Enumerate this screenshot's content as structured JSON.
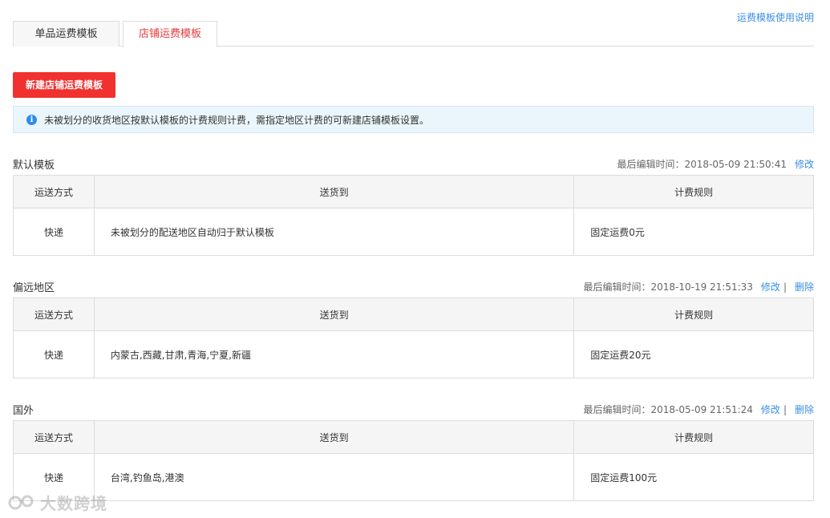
{
  "help_link": "运费模板使用说明",
  "tabs": [
    {
      "label": "单品运费模板",
      "active": false
    },
    {
      "label": "店铺运费模板",
      "active": true
    }
  ],
  "new_button": "新建店铺运费模板",
  "notice": "未被划分的收货地区按默认模板的计费规则计费，需指定地区计费的可新建店铺模板设置。",
  "table_headers": [
    "运送方式",
    "送货到",
    "计费规则"
  ],
  "sections": [
    {
      "title": "默认模板",
      "meta": "最后编辑时间：2018-05-09 21:50:41",
      "edit": "修改",
      "sep": "",
      "delete": "",
      "row": {
        "method": "快递",
        "dest": "未被划分的配送地区自动归于默认模板",
        "rule": "固定运费0元"
      }
    },
    {
      "title": "偏远地区",
      "meta": "最后编辑时间：2018-10-19 21:51:33",
      "edit": "修改",
      "sep": "|",
      "delete": "删除",
      "row": {
        "method": "快递",
        "dest": "内蒙古,西藏,甘肃,青海,宁夏,新疆",
        "rule": "固定运费20元"
      }
    },
    {
      "title": "国外",
      "meta": "最后编辑时间：2018-05-09 21:51:24",
      "edit": "修改",
      "sep": "|",
      "delete": "删除",
      "row": {
        "method": "快递",
        "dest": "台湾,钓鱼岛,港澳",
        "rule": "固定运费100元"
      }
    }
  ],
  "watermark": "大数跨境",
  "colors": {
    "accent": "#f1312f",
    "link": "#3a8ee6",
    "active_tab_text": "#e4393c",
    "notice_bg": "#eaf6fc"
  }
}
